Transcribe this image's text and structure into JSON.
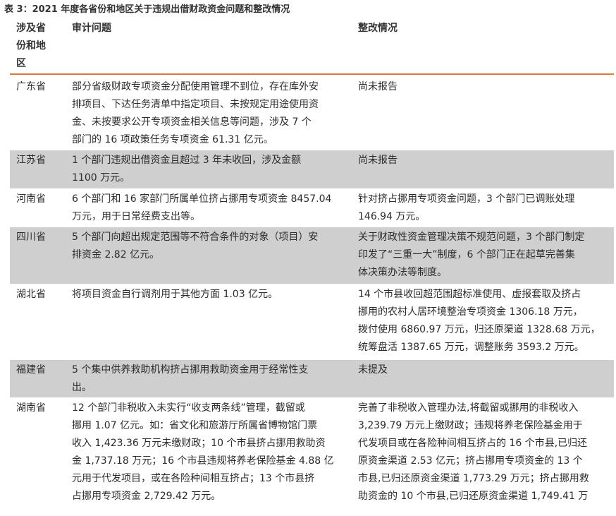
{
  "caption": "表 3：2021 年度各省份和地区关于违规出借财政资金问题和整改情况",
  "headers": {
    "region": "涉及省\n份和地\n区",
    "issue": "审计问题",
    "rectify": "整改情况"
  },
  "rows": [
    {
      "region": "广东省",
      "issue": "部分省级财政专项资金分配使用管理不到位，存在库外安\n排项目、下达任务清单中指定项目、未按规定用途使用资\n金、未按要求公开专项资金相关信息等问题，涉及 7 个\n部门的 16 项政策任务专项资金 61.31 亿元。",
      "rectify": "尚未报告"
    },
    {
      "region": "江苏省",
      "issue": "1 个部门违规出借资金且超过 3 年未收回，涉及金额\n1100 万元。",
      "rectify": "尚未报告"
    },
    {
      "region": "河南省",
      "issue": "6 个部门和 16 家部门所属单位挤占挪用专项资金 8457.04\n万元，用于日常经费支出等。",
      "rectify": "针对挤占挪用专项资金问题，3 个部门已调账处理\n146.94 万元。"
    },
    {
      "region": "四川省",
      "issue": "5 个部门向超出规定范围等不符合条件的对象（项目）安\n排资金 2.82 亿元。",
      "rectify": "关于财政性资金管理决策不规范问题，3 个部门制定\n印发了“三重一大”制度，6 个部门正在起草完善集\n体决策办法等制度。"
    },
    {
      "region": "湖北省",
      "issue": "将项目资金自行调剂用于其他方面 1.03 亿元。",
      "rectify": "14 个市县收回超范围超标准使用、虚报套取及挤占\n挪用的农村人居环境整治专项资金 1306.18 万元，\n拨付使用 6860.97 万元，归还原渠道 1328.68 万元，\n统筹盘活 1387.65 万元，调整账务 3593.2 万元。"
    },
    {
      "region": "福建省",
      "issue": "5 个集中供养救助机构挤占挪用救助资金用于经常性支\n出。",
      "rectify": "未提及"
    },
    {
      "region": "湖南省",
      "issue": "12 个部门非税收入未实行“收支两条线”管理，截留或\n挪用 1.07 亿元。如：省文化和旅游厅所属省博物馆门票\n收入 1,423.36 万元未缴财政；10 个市县挤占挪用救助资\n金 1,737.18 万元；16 个市县违规将养老保险基金 4.88 亿\n元用于代发项目，或在各险种间相互挤占；13 个市县挤\n占挪用专项资金 2,729.42 万元。",
      "rectify": "完善了非税收入管理办法,将截留或挪用的非税收入\n3,239.79 万元上缴财政；违规将养老保险基金用于\n代发项目或在各险种间相互挤占的 16 个市县,已归还\n原资金渠道 2.53 亿元；挤占挪用专项资金的 13 个\n市县,已归还原资金渠道 1,773.29 万元；挤占挪用救\n助资金的 10 个市县,已归还原资金渠道 1,749.41 万"
    }
  ]
}
